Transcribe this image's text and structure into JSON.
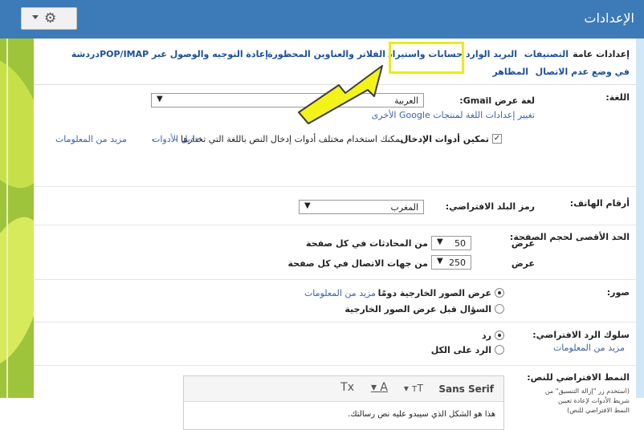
{
  "header": {
    "title": "الإعدادات",
    "gear": "gear-icon"
  },
  "tabs": [
    "إعدادات عامة",
    "التصنيفات",
    "البريد الوارد",
    "حسابات واستيراد",
    "الفلاتر والعناوين المحظورة",
    "إعادة التوجيه والوصول عبر POP/IMAP",
    "دردشة",
    "في وضع عدم الاتصال",
    "المظاهر"
  ],
  "language": {
    "label": "اللغة:",
    "field_label": "لغة عرض Gmail:",
    "value": "العربية",
    "link": "تغيير إعدادات اللغة لمنتجات Google الأخرى",
    "enable_input": "تمكين أدوات الإدخال",
    "input_desc": "- يمكنك استخدام مختلف أدوات إدخال النص باللغة التي تختارها -",
    "edit_tools": "تعديل الأدوات",
    "sep": "-",
    "more_info": "مزيد من المعلومات"
  },
  "phone": {
    "label": "أرقام الهاتف:",
    "field_label": "رمز البلد الافتراضي:",
    "value": "المغرب"
  },
  "page_size": {
    "label": "الحد الأقصى لحجم الصفحة:",
    "show": "عرض",
    "conv_value": "50",
    "conv_label": "من المحادثات في كل صفحة",
    "contacts_value": "250",
    "contacts_label": "من جهات الاتصال في كل صفحة"
  },
  "images": {
    "label": "صور:",
    "always": "عرض الصور الخارجية دومًا",
    "dash": "-",
    "more_info": "مزيد من المعلومات",
    "ask": "السؤال قبل عرض الصور الخارجية"
  },
  "reply": {
    "label": "سلوك الرد الافتراضي:",
    "more_info": "مزيد من المعلومات",
    "reply": "رد",
    "reply_all": "الرد على الكل"
  },
  "text_style": {
    "label": "النمط الافتراضي للنص:",
    "hint": "(استخدم زر \"إزالة التنسيق\" من شريط الأدوات لإعادة تعيين النمط الافتراضي للنص)",
    "font": "Sans Serif",
    "sample": "هذا هو الشكل الذي سيبدو عليه نص رسالتك."
  }
}
